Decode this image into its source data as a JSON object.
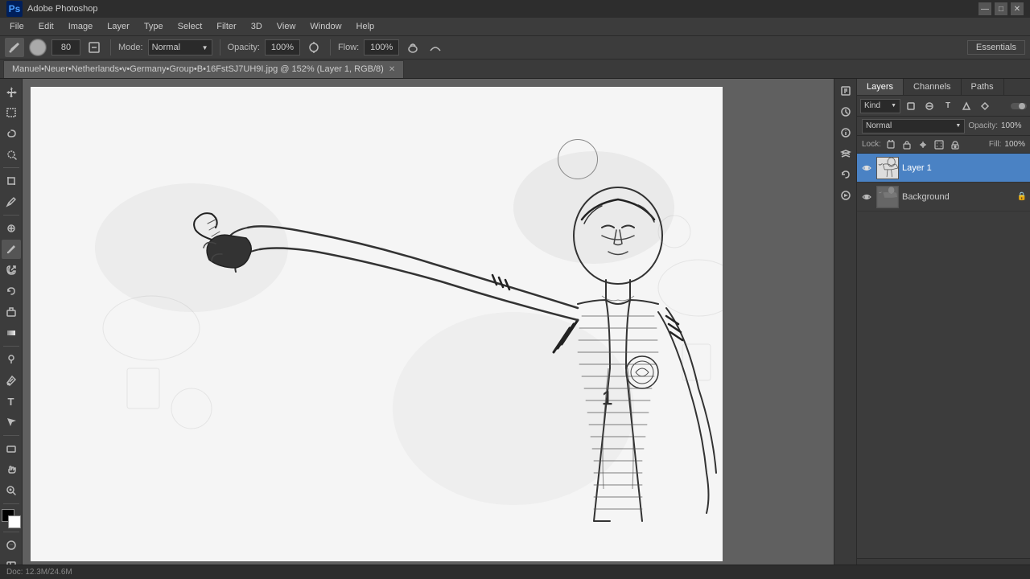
{
  "titlebar": {
    "logo": "Ps",
    "title": "Adobe Photoshop",
    "minimize": "—",
    "maximize": "□",
    "close": "✕"
  },
  "menubar": {
    "items": [
      "File",
      "Edit",
      "Image",
      "Layer",
      "Type",
      "Select",
      "Filter",
      "3D",
      "View",
      "Window",
      "Help"
    ]
  },
  "optionsbar": {
    "brush_size": "80",
    "mode_label": "Mode:",
    "mode_value": "Normal",
    "opacity_label": "Opacity:",
    "opacity_value": "100%",
    "flow_label": "Flow:",
    "flow_value": "100%",
    "essentials": "Essentials"
  },
  "document": {
    "tab_title": "Manuel•Neuer•Netherlands•v•Germany•Group•B•16FstSJ7UH9I.jpg @ 152% (Layer 1, RGB/8)",
    "tab_close": "✕"
  },
  "layers_panel": {
    "tabs": [
      "Layers",
      "Channels",
      "Paths"
    ],
    "active_tab": "Layers",
    "kind_label": "Kind",
    "blend_mode": "Normal",
    "opacity_label": "Opacity:",
    "opacity_value": "100%",
    "lock_label": "Lock:",
    "fill_label": "Fill:",
    "fill_value": "100%",
    "layers": [
      {
        "name": "Layer 1",
        "visible": true,
        "active": true,
        "locked": false,
        "thumb_type": "sketch"
      },
      {
        "name": "Background",
        "visible": true,
        "active": false,
        "locked": true,
        "thumb_type": "photo"
      }
    ]
  },
  "toolbar": {
    "tools": [
      {
        "name": "move",
        "icon": "✥",
        "label": "Move Tool"
      },
      {
        "name": "marquee",
        "icon": "⬚",
        "label": "Marquee Tool"
      },
      {
        "name": "lasso",
        "icon": "⌾",
        "label": "Lasso Tool"
      },
      {
        "name": "quick-select",
        "icon": "✦",
        "label": "Quick Select"
      },
      {
        "name": "crop",
        "icon": "⊡",
        "label": "Crop Tool"
      },
      {
        "name": "eyedropper",
        "icon": "✒",
        "label": "Eyedropper"
      },
      {
        "name": "healing",
        "icon": "⊕",
        "label": "Healing Brush"
      },
      {
        "name": "brush",
        "icon": "🖌",
        "label": "Brush Tool",
        "active": true
      },
      {
        "name": "clone",
        "icon": "⎘",
        "label": "Clone Stamp"
      },
      {
        "name": "history",
        "icon": "↺",
        "label": "History Brush"
      },
      {
        "name": "eraser",
        "icon": "◻",
        "label": "Eraser"
      },
      {
        "name": "gradient",
        "icon": "◫",
        "label": "Gradient"
      },
      {
        "name": "dodge",
        "icon": "◯",
        "label": "Dodge Tool"
      },
      {
        "name": "pen",
        "icon": "✏",
        "label": "Pen Tool"
      },
      {
        "name": "text",
        "icon": "T",
        "label": "Text Tool"
      },
      {
        "name": "path-select",
        "icon": "↗",
        "label": "Path Selection"
      },
      {
        "name": "shape",
        "icon": "▭",
        "label": "Shape Tool"
      },
      {
        "name": "hand",
        "icon": "✋",
        "label": "Hand Tool"
      },
      {
        "name": "zoom",
        "icon": "🔍",
        "label": "Zoom Tool"
      }
    ]
  }
}
